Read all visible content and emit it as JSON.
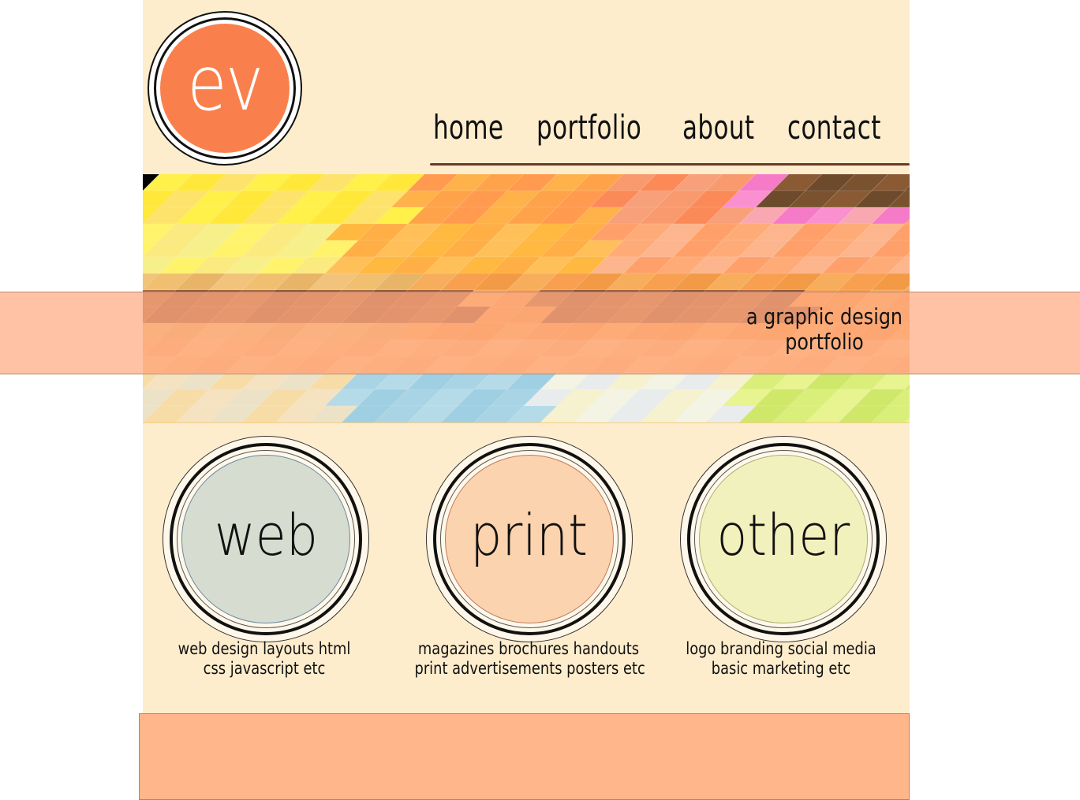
{
  "logo": {
    "text": "ev",
    "color": "#f9804d"
  },
  "nav": {
    "home": "home",
    "portfolio": "portfolio",
    "about": "about",
    "contact": "contact"
  },
  "hero": {
    "tagline_line1": "a graphic design",
    "tagline_line2": "portfolio"
  },
  "categories": [
    {
      "label": "web",
      "color": "#d6dcd0",
      "line1": "web design  layouts  html",
      "line2": "css  javascript  etc"
    },
    {
      "label": "print",
      "color": "#fbd3ae",
      "line1": "magazines  brochures  handouts",
      "line2": "print advertisements  posters  etc"
    },
    {
      "label": "other",
      "color": "#f1f1bd",
      "line1": "logo  branding  social media",
      "line2": "basic marketing  etc"
    }
  ],
  "colors": {
    "page_bg": "#fdedcd",
    "accent": "#ffb68a",
    "nav_line": "#6e3a25"
  }
}
